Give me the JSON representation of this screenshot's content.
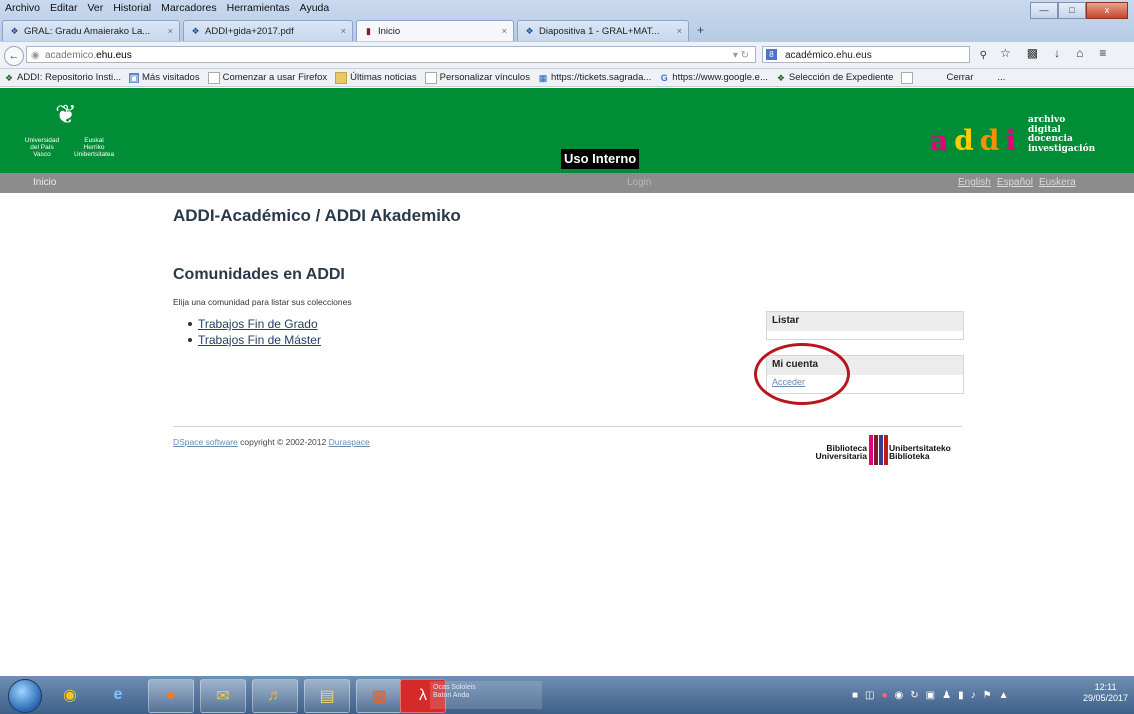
{
  "browser": {
    "menu": [
      "Archivo",
      "Editar",
      "Ver",
      "Historial",
      "Marcadores",
      "Herramientas",
      "Ayuda"
    ],
    "window_controls": {
      "minimize": "—",
      "maximize": "□",
      "close": "x"
    },
    "tabs": [
      {
        "icon": "ehu-icon",
        "label": "GRAL: Gradu Amaierako La...",
        "close": "×"
      },
      {
        "icon": "ehu-icon",
        "label": "ADDI+gida+2017.pdf",
        "close": "×"
      },
      {
        "icon": "page-icon",
        "label": "Inicio",
        "close": "×"
      },
      {
        "icon": "ehu-icon",
        "label": "Diapositiva 1 - GRAL+MAT...",
        "close": "×"
      }
    ],
    "new_tab": "+",
    "url": {
      "prefix": "academico.",
      "host": "ehu.eus"
    },
    "search": {
      "value": "académico.ehu.eus"
    },
    "bookmarks": [
      {
        "icon": "ehu",
        "label": "ADDI: Repositorio Insti..."
      },
      {
        "icon": "img",
        "label": "Más visitados"
      },
      {
        "icon": "blank",
        "label": "Comenzar a usar Firefox"
      },
      {
        "icon": "folder",
        "label": "Últimas noticias"
      },
      {
        "icon": "blank",
        "label": "Personalizar vínculos"
      },
      {
        "icon": "dir",
        "label": "https://tickets.sagrada..."
      },
      {
        "icon": "g",
        "label": "https://www.google.e..."
      },
      {
        "icon": "ehu",
        "label": "Selección de Expediente"
      },
      {
        "icon": "blank",
        "label": ""
      },
      {
        "icon": "none",
        "label": "Cerrar"
      },
      {
        "icon": "none",
        "label": "..."
      }
    ]
  },
  "header": {
    "university_lines_left": [
      "Universidad",
      "del País Vasco"
    ],
    "university_lines_right": [
      "Euskal Herriko",
      "Unibertsitatea"
    ],
    "uso_interno": "Uso Interno",
    "addi_letters": [
      "a",
      "d",
      "d",
      "i"
    ],
    "addi_words": [
      "archivo",
      "digital",
      "docencia",
      "investigación"
    ]
  },
  "subnav": {
    "inicio": "Inicio",
    "login": "Login",
    "langs": [
      "English",
      "Español",
      "Euskera"
    ]
  },
  "main": {
    "title": "ADDI-Académico / ADDI Akademiko",
    "section_title": "Comunidades en ADDI",
    "intro": "Elija una comunidad para listar sus colecciones",
    "communities": [
      "Trabajos Fin de Grado",
      "Trabajos Fin de Máster"
    ]
  },
  "sidebar": {
    "listar_title": "Listar",
    "cuenta_title": "Mi cuenta",
    "acceder": "Acceder"
  },
  "footer": {
    "dspace": "DSpace software",
    "copyright": "copyright © 2002-2012",
    "duraspace": "Duraspace",
    "biblio_left": [
      "Biblioteca",
      "Universitaria"
    ],
    "biblio_right": [
      "Unibertsitateko",
      "Biblioteka"
    ],
    "biblio_colors": [
      "#e5007d",
      "#7a1a2a",
      "#3b3b8f",
      "#c21a1a"
    ]
  },
  "taskbar": {
    "clock_time": "12:11",
    "clock_date": "29/05/2017",
    "ghost_text": [
      "Ocas Sololeis",
      "Baton Anda"
    ]
  }
}
